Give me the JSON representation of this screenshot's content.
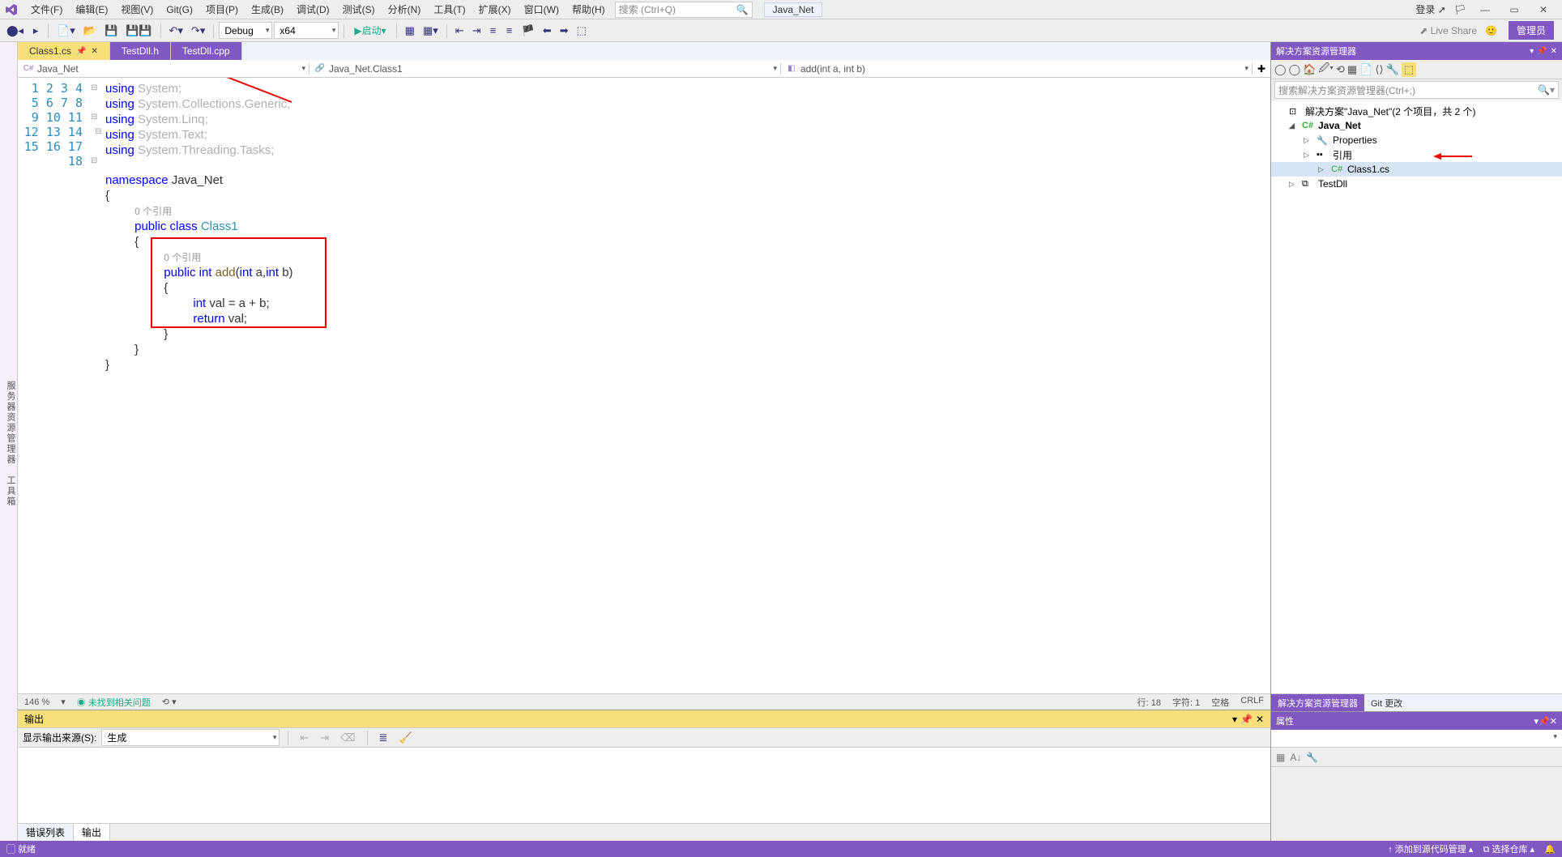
{
  "menu": {
    "file": "文件(F)",
    "edit": "编辑(E)",
    "view": "视图(V)",
    "git": "Git(G)",
    "project": "项目(P)",
    "build": "生成(B)",
    "debug": "调试(D)",
    "test": "测试(S)",
    "analyze": "分析(N)",
    "tools": "工具(T)",
    "extensions": "扩展(X)",
    "window": "窗口(W)",
    "help": "帮助(H)"
  },
  "search": {
    "placeholder": "搜索 (Ctrl+Q)"
  },
  "project_name": "Java_Net",
  "login": "登录",
  "toolbar": {
    "config": "Debug",
    "platform": "x64",
    "start": "启动",
    "live_share": "Live Share",
    "admin": "管理员"
  },
  "tabs": [
    {
      "name": "Class1.cs",
      "active": true
    },
    {
      "name": "TestDll.h",
      "active": false
    },
    {
      "name": "TestDll.cpp",
      "active": false
    }
  ],
  "context": {
    "project": "Java_Net",
    "class": "Java_Net.Class1",
    "method": "add(int a, int b)"
  },
  "code": {
    "lines": [
      "1",
      "2",
      "3",
      "4",
      "5",
      "6",
      "7",
      "8",
      "",
      "9",
      "10",
      "",
      "11",
      "12",
      "13",
      "14",
      "15",
      "16",
      "17",
      "18"
    ],
    "l1a": "using ",
    "l1b": "System",
    "l2a": "using ",
    "l2b": "System.Collections.Generic",
    "l3a": "using ",
    "l3b": "System.Linq",
    "l4a": "using ",
    "l4b": "System.Text",
    "l5a": "using ",
    "l5b": "System.Threading.Tasks",
    "l7a": "namespace ",
    "l7b": "Java_Net",
    "brace_open": "{",
    "brace_close": "}",
    "ref0": "0 个引用",
    "l9a": "public ",
    "l9b": "class ",
    "l9c": "Class1",
    "l11a": "public ",
    "l11b": "int ",
    "l11c": "add",
    "l11d": "(",
    "l11e": "int ",
    "l11f": "a,",
    "l11g": "int ",
    "l11h": "b)",
    "l13a": "int ",
    "l13b": "val = a + b;",
    "l14a": "return ",
    "l14b": "val;",
    "semi": ";"
  },
  "ed_status": {
    "zoom": "146 %",
    "issues": "未找到相关问题",
    "line": "行: 18",
    "col": "字符: 1",
    "spaces": "空格",
    "eol": "CRLF"
  },
  "output": {
    "title": "输出",
    "label": "显示输出来源(S):",
    "source": "生成"
  },
  "bottom_tabs": {
    "errors": "错误列表",
    "output": "输出"
  },
  "solution": {
    "title": "解决方案资源管理器",
    "search": "搜索解决方案资源管理器(Ctrl+;)",
    "root": "解决方案\"Java_Net\"(2 个项目，共 2 个)",
    "proj": "Java_Net",
    "props": "Properties",
    "refs": "引用",
    "class": "Class1.cs",
    "testdll": "TestDll"
  },
  "side_tabs": {
    "se": "解决方案资源管理器",
    "git": "Git 更改"
  },
  "properties": {
    "title": "属性"
  },
  "status": {
    "ready": "就绪",
    "src": "添加到源代码管理",
    "repo": "选择仓库"
  }
}
